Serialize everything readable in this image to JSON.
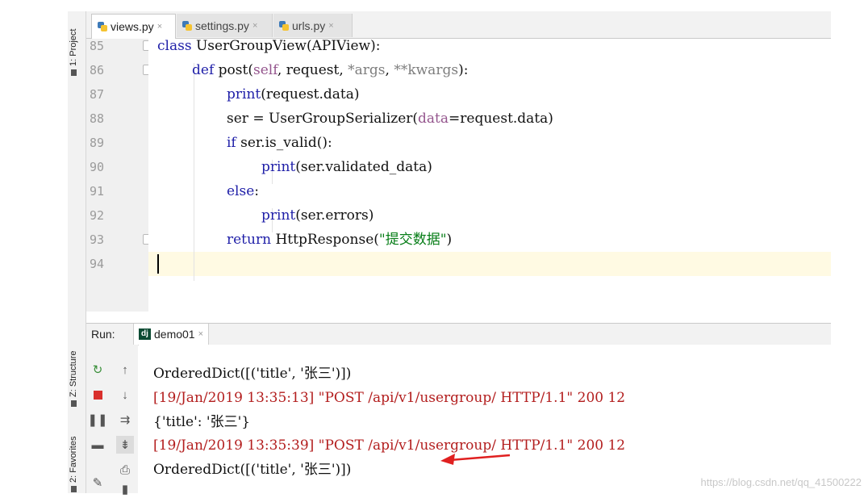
{
  "sidebar": {
    "project_label": "1: Project",
    "structure_label": "Z: Structure",
    "favorites_label": "2: Favorites"
  },
  "tabs": [
    {
      "label": "views.py",
      "close": "×"
    },
    {
      "label": "settings.py",
      "close": "×"
    },
    {
      "label": "urls.py",
      "close": "×"
    }
  ],
  "editor": {
    "line_numbers": [
      "85",
      "86",
      "87",
      "88",
      "89",
      "90",
      "91",
      "92",
      "93",
      "94"
    ],
    "l85": {
      "kw": "class",
      "rest": " UserGroupView(APIView):"
    },
    "l86": {
      "kw": "def",
      "name": " post(",
      "self": "self",
      "mid": ", request, ",
      "args": "*args",
      "sep": ", ",
      "kwargs": "**kwargs",
      "end": "):"
    },
    "l87": {
      "bi": "print",
      "rest": "(request.data)"
    },
    "l88": {
      "pre": "ser = UserGroupSerializer(",
      "param": "data",
      "rest": "=request.data)"
    },
    "l89": {
      "kw": "if",
      "rest": " ser.is_valid():"
    },
    "l90": {
      "bi": "print",
      "rest": "(ser.validated_data)"
    },
    "l91": {
      "kw": "else",
      "rest": ":"
    },
    "l92": {
      "bi": "print",
      "rest": "(ser.errors)"
    },
    "l93": {
      "kw": "return",
      "pre": " HttpResponse(",
      "str": "\"提交数据\"",
      "end": ")"
    }
  },
  "run": {
    "label": "Run:",
    "config": "demo01",
    "close": "×",
    "output": [
      {
        "text": "OrderedDict([('title', '张三')])",
        "red": false
      },
      {
        "text": "[19/Jan/2019 13:35:13] \"POST /api/v1/usergroup/ HTTP/1.1\" 200 12",
        "red": true
      },
      {
        "text": "{'title': '张三'}",
        "red": false
      },
      {
        "text": "[19/Jan/2019 13:35:39] \"POST /api/v1/usergroup/ HTTP/1.1\" 200 12",
        "red": true
      },
      {
        "text": "OrderedDict([('title', '张三')])",
        "red": false
      }
    ],
    "buttons": [
      "rerun-icon",
      "arrow-up-icon",
      "stop-icon",
      "arrow-down-icon",
      "pause-icon",
      "soft-wrap-icon",
      "layout-icon",
      "scroll-to-end-icon",
      "print-icon",
      "pin-icon",
      "trash-icon"
    ]
  },
  "colors": {
    "annotation_arrow": "#e02020",
    "current_line": "#fffae3"
  },
  "watermark": "https://blog.csdn.net/qq_41500222"
}
